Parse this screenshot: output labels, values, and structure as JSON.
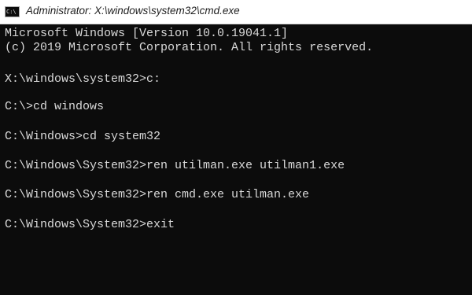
{
  "window": {
    "title": "Administrator: X:\\windows\\system32\\cmd.exe",
    "icon_label": "C:\\",
    "icon": "cmd-icon",
    "colors": {
      "background": "#0c0c0c",
      "text": "#d9d9d9",
      "titlebar": "#ffffff"
    }
  },
  "console": {
    "lines": [
      "Microsoft Windows [Version 10.0.19041.1]",
      "(c) 2019 Microsoft Corporation. All rights reserved.",
      "X:\\windows\\system32>c:",
      "C:\\>cd windows",
      "C:\\Windows>cd system32",
      "C:\\Windows\\System32>ren utilman.exe utilman1.exe",
      "C:\\Windows\\System32>ren cmd.exe utilman.exe",
      "C:\\Windows\\System32>exit"
    ]
  }
}
